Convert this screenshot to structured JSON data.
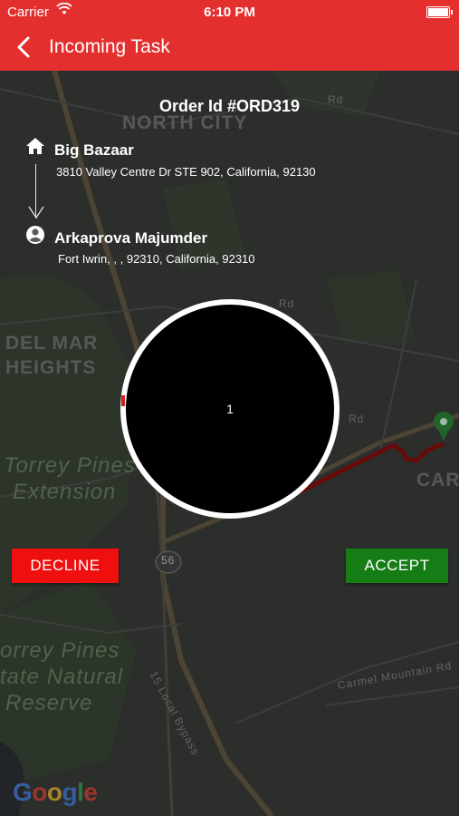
{
  "status_bar": {
    "carrier": "Carrier",
    "time": "6:10 PM"
  },
  "nav": {
    "title": "Incoming Task"
  },
  "order": {
    "id_label": "Order Id #ORD319"
  },
  "pickup": {
    "name": "Big Bazaar",
    "address": "3810 Valley Centre Dr STE 902, California, 92130"
  },
  "dropoff": {
    "name": "Arkaprova Majumder",
    "address": "Fort Iwrin, , , 92310, California, 92310"
  },
  "timer": {
    "value": "1"
  },
  "actions": {
    "decline": "DECLINE",
    "accept": "ACCEPT"
  },
  "map": {
    "labels": {
      "north_city": "NORTH CITY",
      "del_mar_1": "DEL MAR",
      "del_mar_2": "HEIGHTS",
      "torrey_1": "Torrey Pines",
      "torrey_2": "Extension",
      "reserve_1": "orrey Pines",
      "reserve_2": "tate Natural",
      "reserve_3": "Reserve",
      "carm": "CARM",
      "highway": "56",
      "rd1": "Rd",
      "rd2": "Rd",
      "rd3": "Rd",
      "carmel_mountain": "Carmel Mountain Rd",
      "bypass": "15 Local Bypass"
    },
    "attribution": "Google"
  },
  "colors": {
    "brand_red": "#e42f2f",
    "decline_red": "#ef0f0f",
    "accept_green": "#167d16",
    "route_red": "#8c1010"
  }
}
